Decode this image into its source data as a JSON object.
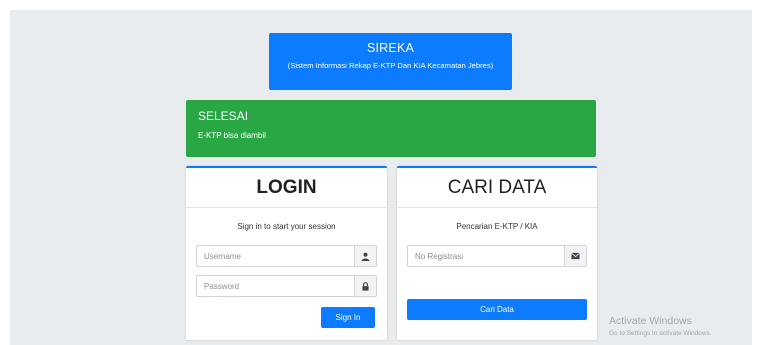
{
  "banner": {
    "title": "SIREKA",
    "subtitle": "(Sistem Informasi Rekap E-KTP Dan KIA Kecamatan Jebres)"
  },
  "alert": {
    "title": "SELESAI",
    "text": "E-KTP bisa diambil"
  },
  "login": {
    "title": "LOGIN",
    "message": "Sign in to start your session",
    "username_placeholder": "Username",
    "username_icon": "user-icon",
    "password_placeholder": "Password",
    "password_icon": "lock-icon",
    "submit_label": "Sign In"
  },
  "search": {
    "title": "CARI DATA",
    "message": "Pencarian E-KTP / KIA",
    "registration_placeholder": "No Registrasi",
    "registration_icon": "envelope-icon",
    "submit_label": "Cari Data"
  },
  "watermark": {
    "title": "Activate Windows",
    "subtitle": "Go to Settings to activate Windows."
  },
  "colors": {
    "primary": "#0d7bfd",
    "success": "#29a745",
    "page_background": "#e9ecef"
  }
}
